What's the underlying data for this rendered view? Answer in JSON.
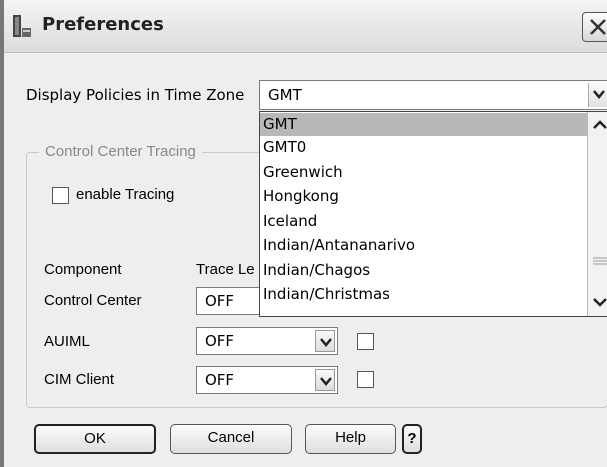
{
  "window": {
    "title": "Preferences"
  },
  "timezone": {
    "label": "Display Policies in Time Zone",
    "selected": "GMT",
    "options": [
      "GMT",
      "GMT0",
      "Greenwich",
      "Hongkong",
      "Iceland",
      "Indian/Antananarivo",
      "Indian/Chagos",
      "Indian/Christmas"
    ],
    "highlighted_index": 0
  },
  "tracing": {
    "group_title": "Control Center Tracing",
    "enable_label": "enable Tracing",
    "enabled": false,
    "columns": {
      "component": "Component",
      "trace_level": "Trace Le"
    },
    "rows": [
      {
        "component": "Control Center",
        "level": "OFF"
      },
      {
        "component": "AUIML",
        "level": "OFF",
        "checked": false
      },
      {
        "component": "CIM Client",
        "level": "OFF",
        "checked": false
      }
    ]
  },
  "buttons": {
    "ok": "OK",
    "cancel": "Cancel",
    "help": "Help",
    "context_help": "?"
  },
  "icons": {
    "app": "preferences-window-icon",
    "close": "close-icon",
    "dropdown": "chevron-down-icon",
    "scroll_up": "chevron-up-icon",
    "scroll_down": "chevron-down-icon",
    "scroll_grip": "scroll-grip-icon"
  },
  "colors": {
    "selection": "#b8b8b8",
    "window_bg": "#eeeeee"
  }
}
